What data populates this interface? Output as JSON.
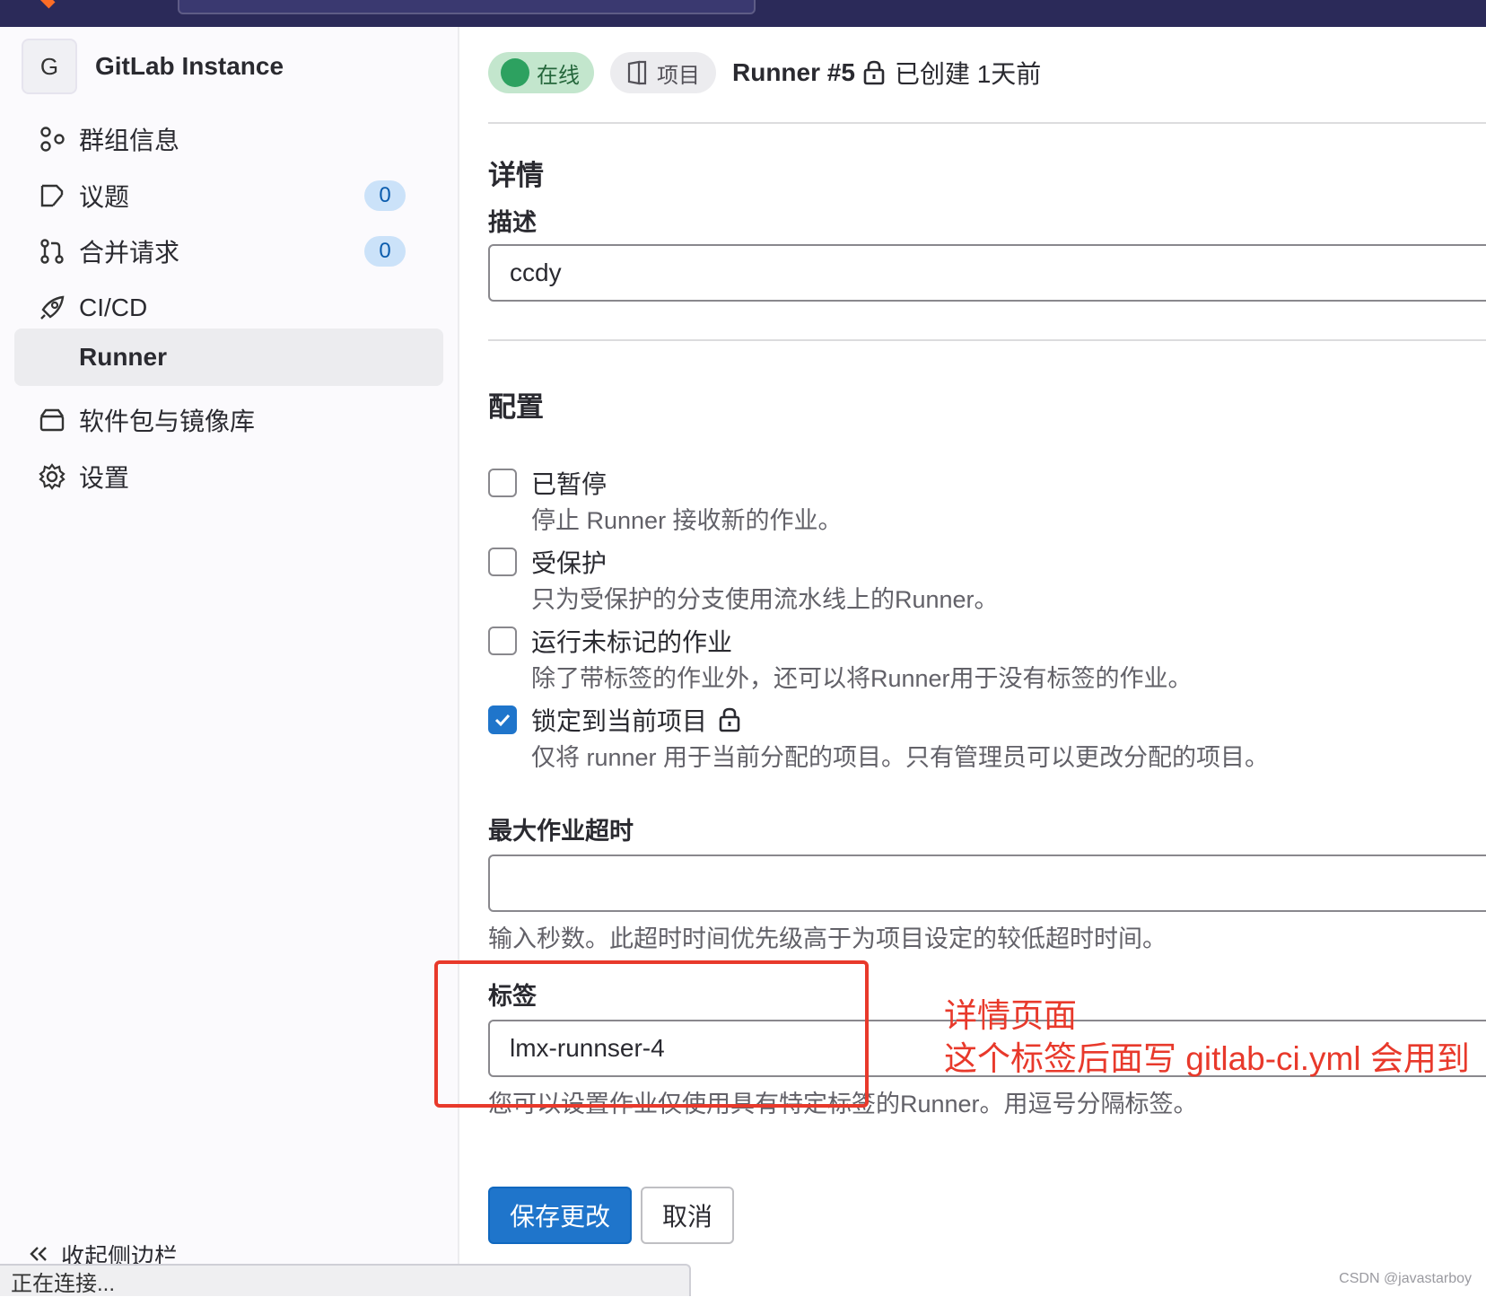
{
  "sidebar": {
    "context_avatar": "G",
    "context_title": "GitLab Instance",
    "items": [
      {
        "label": "群组信息",
        "icon": "group-icon"
      },
      {
        "label": "议题",
        "icon": "issues-icon",
        "badge": "0"
      },
      {
        "label": "合并请求",
        "icon": "merge-request-icon",
        "badge": "0"
      },
      {
        "label": "CI/CD",
        "icon": "rocket-icon"
      },
      {
        "label": "Runner",
        "active": true
      },
      {
        "label": "软件包与镜像库",
        "icon": "package-icon"
      },
      {
        "label": "设置",
        "icon": "settings-icon"
      }
    ],
    "collapse_label": "收起侧边栏"
  },
  "statusbar": {
    "text": "正在连接..."
  },
  "header": {
    "status_label": "在线",
    "type_label": "项目",
    "runner_title": "Runner #5",
    "created_text": "已创建 1天前"
  },
  "details": {
    "heading": "详情",
    "description_label": "描述",
    "description_value": "ccdy"
  },
  "config": {
    "heading": "配置",
    "options": [
      {
        "title": "已暂停",
        "help": "停止 Runner 接收新的作业。",
        "checked": false
      },
      {
        "title": "受保护",
        "help": "只为受保护的分支使用流水线上的Runner。",
        "checked": false
      },
      {
        "title": "运行未标记的作业",
        "help": "除了带标签的作业外，还可以将Runner用于没有标签的作业。",
        "checked": false
      },
      {
        "title": "锁定到当前项目",
        "help": "仅将 runner 用于当前分配的项目。只有管理员可以更改分配的项目。",
        "checked": true
      }
    ],
    "timeout_label": "最大作业超时",
    "timeout_value": "",
    "timeout_help": "输入秒数。此超时时间优先级高于为项目设定的较低超时时间。",
    "tags_label": "标签",
    "tags_value": "lmx-runnser-4",
    "tags_help": "您可以设置作业仅使用具有特定标签的Runner。用逗号分隔标签。"
  },
  "buttons": {
    "save": "保存更改",
    "cancel": "取消"
  },
  "annotation": {
    "line1": "详情页面",
    "line2": "这个标签后面写 gitlab-ci.yml 会用到",
    "color": "#e8392b"
  },
  "watermark": "CSDN @javastarboy"
}
